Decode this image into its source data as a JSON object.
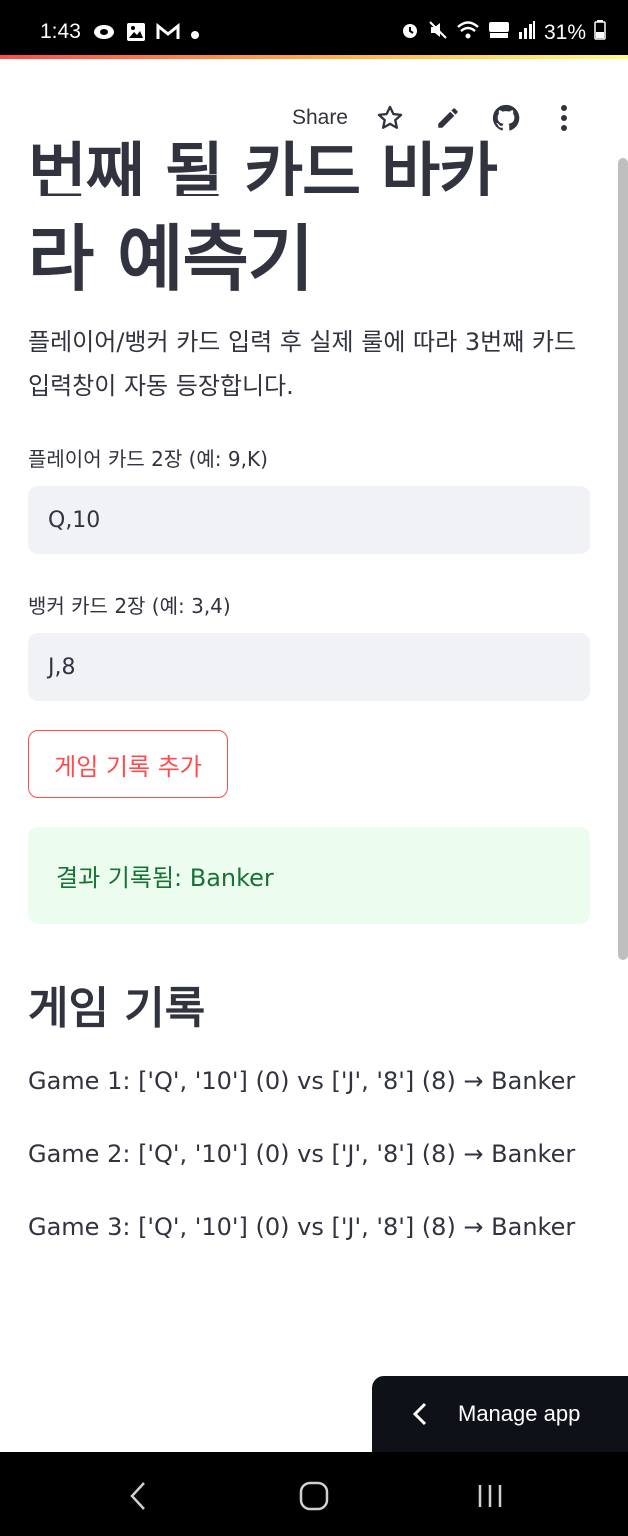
{
  "status_bar": {
    "time": "1:43",
    "battery": "31%",
    "left_icons": [
      "eye-icon",
      "gallery-icon",
      "gmail-icon",
      "dot-icon"
    ],
    "right_icons": [
      "alarm-icon",
      "mute-icon",
      "wifi-icon",
      "hd-voice-icon",
      "signal-icon",
      "battery-icon"
    ]
  },
  "toolbar": {
    "share_label": "Share",
    "icons": [
      "star-icon",
      "edit-icon",
      "github-icon",
      "more-vert-icon"
    ]
  },
  "header": {
    "title_partial": "번째 될 카드 바카",
    "title": "라 예측기",
    "description": "플레이어/뱅커 카드 입력 후 실제 룰에 따라 3번째 카드 입력창이 자동 등장합니다."
  },
  "form": {
    "player_label": "플레이어 카드 2장 (예: 9,K)",
    "player_value": "Q,10",
    "banker_label": "뱅커 카드 2장 (예: 3,4)",
    "banker_value": "J,8",
    "add_button": "게임 기록 추가"
  },
  "result": {
    "message": "결과 기록됨: Banker",
    "color": "#177233",
    "background": "#ecfdf0"
  },
  "history": {
    "title": "게임 기록",
    "records": [
      "Game 1: ['Q', '10'] (0) vs ['J', '8'] (8) → Banker",
      "Game 2: ['Q', '10'] (0) vs ['J', '8'] (8) → Banker",
      "Game 3: ['Q', '10'] (0) vs ['J', '8'] (8) → Banker"
    ]
  },
  "manage_app": {
    "label": "Manage app"
  },
  "nav_bar": {
    "icons": [
      "back-icon",
      "home-icon",
      "recent-apps-icon"
    ]
  },
  "colors": {
    "accent": "#ff4b4b",
    "text": "#31333f",
    "input_bg": "#f0f2f6"
  }
}
